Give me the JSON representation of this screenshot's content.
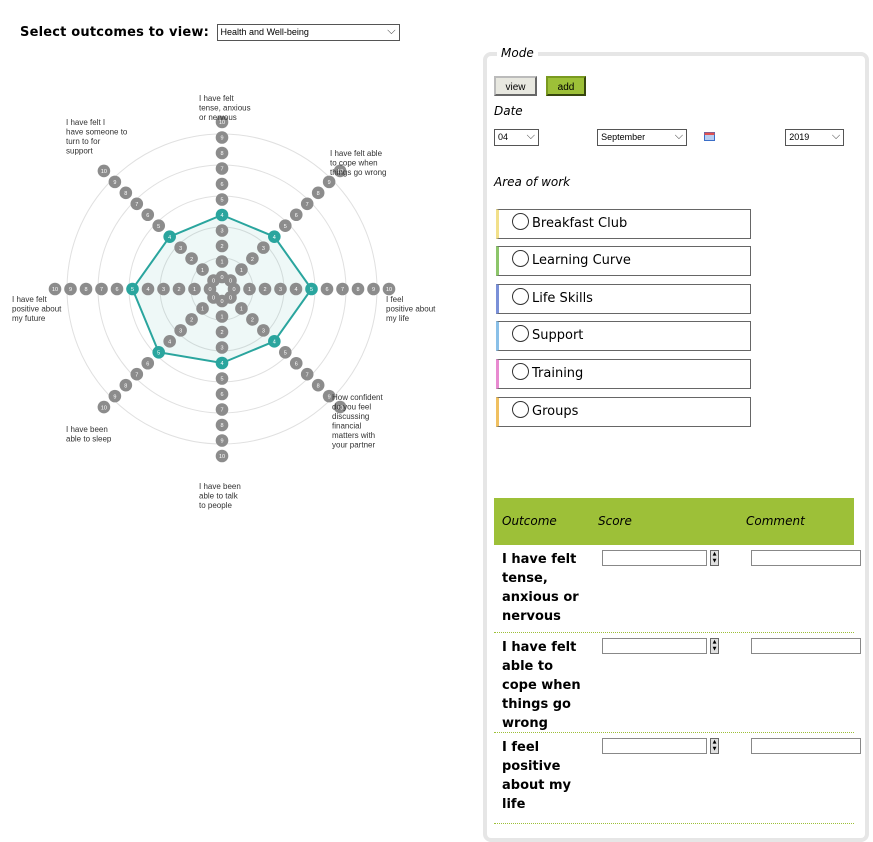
{
  "top": {
    "label": "Select outcomes to view:",
    "selected_outcome_set": "Health and Well-being"
  },
  "radar": {
    "axes": [
      "I have felt tense, anxious or nervous",
      "I have felt able to cope when things go wrong",
      "I feel positive about my life",
      "How confident do you feel discussing financial matters with your partner",
      "I have been able to talk to people",
      "I have been able to sleep",
      "I have felt positive about my future",
      "I have felt I have someone to turn to for support"
    ],
    "scale_max": 10,
    "scores": [
      4,
      4,
      5,
      4,
      4,
      5,
      5,
      4
    ],
    "colors": {
      "point": "#8c8c8c",
      "highlight": "#2aa59e",
      "ring": "#e0e0e0"
    }
  },
  "panel": {
    "mode_label": "Mode",
    "view_label": "view",
    "add_label": "add",
    "date_label": "Date",
    "day": "04",
    "month": "September",
    "year": "2019",
    "area_label": "Area of work",
    "areas": [
      {
        "label": "Breakfast Club",
        "color": "#f2e08a"
      },
      {
        "label": "Learning Curve",
        "color": "#8cc56a"
      },
      {
        "label": "Life Skills",
        "color": "#7a90d8"
      },
      {
        "label": "Support",
        "color": "#8ac0e8"
      },
      {
        "label": "Training",
        "color": "#e88ad0"
      },
      {
        "label": "Groups",
        "color": "#f0c060"
      }
    ],
    "table": {
      "headers": {
        "outcome": "Outcome",
        "score": "Score",
        "comment": "Comment"
      },
      "rows": [
        {
          "outcome": "I have felt tense, anxious or nervous"
        },
        {
          "outcome": "I have felt able to cope when things go wrong"
        },
        {
          "outcome": "I feel positive about my life"
        }
      ],
      "accent": "#9dc038"
    }
  }
}
